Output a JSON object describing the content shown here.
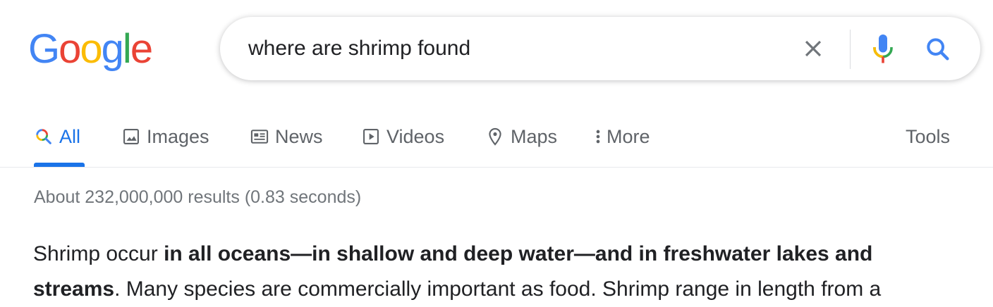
{
  "logo": {
    "letters": [
      "G",
      "o",
      "o",
      "g",
      "l",
      "e"
    ],
    "colors": [
      "#4285f4",
      "#ea4335",
      "#fbbc05",
      "#4285f4",
      "#34a853",
      "#ea4335"
    ]
  },
  "search": {
    "query": "where are shrimp found"
  },
  "tabs": [
    {
      "label": "All",
      "icon": "search-icon"
    },
    {
      "label": "Images",
      "icon": "image-icon"
    },
    {
      "label": "News",
      "icon": "newspaper-icon"
    },
    {
      "label": "Videos",
      "icon": "play-icon"
    },
    {
      "label": "Maps",
      "icon": "map-pin-icon"
    },
    {
      "label": "More",
      "icon": "more-vert-icon"
    }
  ],
  "tools_label": "Tools",
  "result_stats": "About 232,000,000 results (0.83 seconds)",
  "snippet": {
    "lead": "Shrimp occur ",
    "bold": "in all oceans—in shallow and deep water—and in freshwater lakes and streams",
    "tail": ". Many species are commercially important as food. Shrimp range in length from a"
  },
  "colors": {
    "accent": "#1a73e8",
    "tab_text": "#5f6368",
    "stats_text": "#70757a"
  }
}
